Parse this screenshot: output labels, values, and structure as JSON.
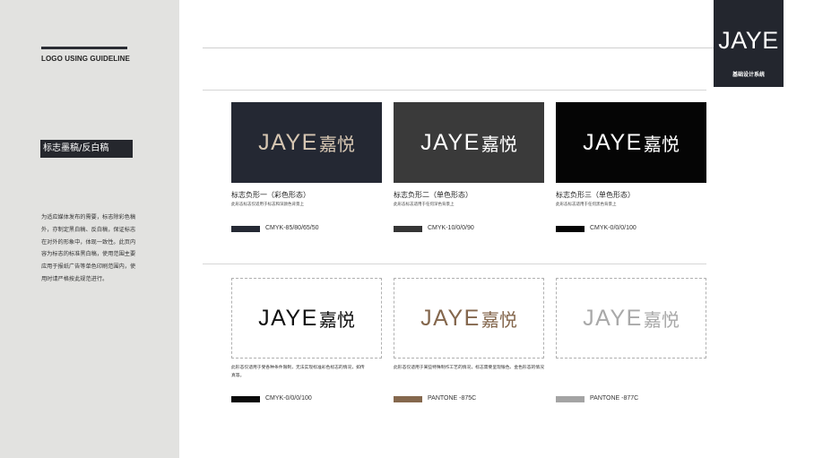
{
  "sidebar": {
    "title": "LOGO USING GUIDELINE",
    "section_label": "标志墨稿/反白稿",
    "description": "为适应媒体发布的需要，标志除彩色稿外，亦制定黑白稿、反白稿，保证标志在对外的形象中，体现一致性。此页内容为标志的标准黑白稿，使用范围主要应用于报纸广告等单色印刷范围内，使用时请严格按此规范进行。"
  },
  "brand": {
    "logo_text": "JAYE",
    "subtitle": "基础设计系统"
  },
  "logo": {
    "latin": "JAYE",
    "chinese": "嘉悦"
  },
  "top_variants": [
    {
      "title": "标志负形一（彩色形态）",
      "subtitle": "此形态标志仅适用于标志和深颜色背景上",
      "swatch_label": "CMYK-85/80/65/50",
      "bg_color": "#242833",
      "logo_color": "#d6c6b2",
      "swatch_color": "#252934"
    },
    {
      "title": "标志负形二（单色形态）",
      "subtitle": "此形态标志适用于任何深色背景上",
      "swatch_label": "CMYK-10/0/0/90",
      "bg_color": "#3a3a3a",
      "logo_color": "#ffffff",
      "swatch_color": "#353535"
    },
    {
      "title": "标志负形三（单色形态）",
      "subtitle": "此形态标志适用于任何黑色背景上",
      "swatch_label": "CMYK-0/0/0/100",
      "bg_color": "#050505",
      "logo_color": "#ffffff",
      "swatch_color": "#050505"
    }
  ],
  "bottom_variants": [
    {
      "note": "此形态仅适用于受各种条件限制，无法实现标准彩色标志的情况，如传真等。",
      "swatch_label": "CMYK-0/0/0/100",
      "logo_color": "#111111",
      "swatch_color": "#0a0a0a"
    },
    {
      "note": "此形态仅适用于某些特殊制作工艺的情况，标志需要呈现银色、金色形态的情况",
      "swatch_label": "PANTONE -875C",
      "logo_color": "#84674d",
      "swatch_color": "#85684d"
    },
    {
      "note": "",
      "swatch_label": "PANTONE -877C",
      "logo_color": "#a9a9a9",
      "swatch_color": "#a4a4a4"
    }
  ]
}
